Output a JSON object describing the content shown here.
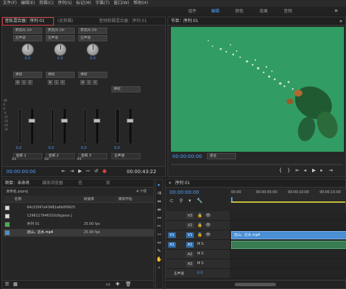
{
  "menu": [
    "文件(F)",
    "编辑(E)",
    "剪辑(C)",
    "序列(S)",
    "标记(M)",
    "字幕(T)",
    "窗口(W)",
    "帮助(H)"
  ],
  "workspaces": [
    "组件",
    "编辑",
    "颜色",
    "效果",
    "音频"
  ],
  "colors": {
    "accent": "#4ea0ff",
    "panel": "#262626",
    "video_green": "#2f9a62",
    "clip_blue": "#4a8fd4",
    "highlight_box": "#d94040"
  },
  "mixer": {
    "tabs": [
      "音轨混合器：序列 01",
      "(无剪辑)",
      "音频剪辑混合器：序列 01"
    ],
    "channels": [
      {
        "input": "表态风 (Ur",
        "output": "主声道",
        "knob": "0.0",
        "mode": "读取",
        "fader": "0.0",
        "name": "音频 1",
        "id": "A1"
      },
      {
        "input": "表态风 (Ur",
        "output": "主声道",
        "knob": "0.0",
        "mode": "读取",
        "fader": "0.0",
        "name": "音频 2",
        "id": "A2"
      },
      {
        "input": "表态风 (Ur",
        "output": "主声道",
        "knob": "0.0",
        "mode": "读取",
        "fader": "0.0",
        "name": "音频 3",
        "id": "A3"
      },
      {
        "input": "",
        "output": "",
        "knob": "",
        "mode": "读取",
        "fader": "0.0",
        "name": "主声道",
        "id": ""
      }
    ],
    "msr": [
      "M",
      "S",
      "R"
    ],
    "scale": [
      "dB",
      "6",
      "0",
      "-6",
      "-12",
      "-18",
      "-24",
      "-30",
      "-36",
      "-42",
      "-48",
      "-54",
      "dB"
    ],
    "timecode_left": "00:00:00:00",
    "timecode_right": "00:00:43:22"
  },
  "program": {
    "title": "节目：序列 01",
    "timecode": "00:00:00:00",
    "fit": "适合"
  },
  "project": {
    "tabs": [
      "项目：未命名",
      "媒体浏览器",
      "信",
      "效"
    ],
    "file": "未命名.prproj",
    "count": "4 个项",
    "columns": [
      "名称",
      "帧速率",
      "媒体开始"
    ],
    "items": [
      {
        "name": "64c53f47e43482a6b0f9925",
        "fps": "",
        "color": "#bfbfbf"
      },
      {
        "name": "1296117946310c6qjexsr.j",
        "fps": "",
        "color": "#bfbfbf"
      },
      {
        "name": "序列 01",
        "fps": "25.00 fps",
        "color": "#3fb04a"
      },
      {
        "name": "迈山，达水.mp4",
        "fps": "25.00 fps",
        "color": "#4a8fd4"
      }
    ]
  },
  "timeline": {
    "title": "序列 01",
    "timecode": "00:00:00:00",
    "ruler": [
      "00:00",
      "00:00:05:00",
      "00:00:10:00",
      "00:00:15:00"
    ],
    "tracks": [
      {
        "id": "V3",
        "src": "",
        "toggles": "",
        "type": "video"
      },
      {
        "id": "V2",
        "src": "",
        "toggles": "",
        "type": "video"
      },
      {
        "id": "V1",
        "src": "V1",
        "toggles": "",
        "type": "video"
      },
      {
        "id": "A1",
        "src": "A1",
        "toggles": "M S",
        "type": "audio"
      },
      {
        "id": "A2",
        "src": "",
        "toggles": "M S",
        "type": "audio"
      },
      {
        "id": "A3",
        "src": "",
        "toggles": "M S",
        "type": "audio"
      },
      {
        "id": "主声道",
        "src": "",
        "toggles": "0.0",
        "type": "master"
      }
    ],
    "clip": "迈山，达水.mp4"
  }
}
